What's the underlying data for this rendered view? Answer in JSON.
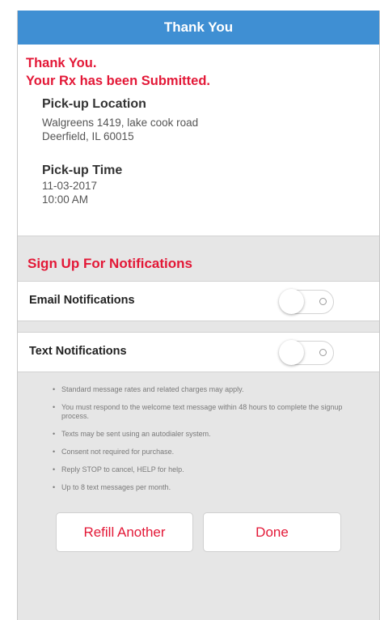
{
  "header": {
    "title": "Thank You"
  },
  "confirmation": {
    "line1": "Thank You.",
    "line2": "Your Rx has been Submitted."
  },
  "pickup_location": {
    "heading": "Pick-up Location",
    "address_line1": "Walgreens 1419, lake cook road",
    "address_line2": "Deerfield, IL 60015"
  },
  "pickup_time": {
    "heading": "Pick-up Time",
    "date": "11-03-2017",
    "time": "10:00 AM"
  },
  "notifications": {
    "heading": "Sign Up For Notifications",
    "email": {
      "label": "Email Notifications",
      "on": false
    },
    "text": {
      "label": "Text Notifications",
      "on": false
    },
    "disclaimers": [
      "Standard message rates and related charges may apply.",
      "You must respond to the welcome text message within 48 hours to complete the signup process.",
      "Texts may be sent using an autodialer system.",
      "Consent not required for purchase.",
      "Reply STOP to cancel, HELP for help.",
      "Up to 8 text messages per month."
    ]
  },
  "actions": {
    "refill_label": "Refill Another",
    "done_label": "Done"
  },
  "colors": {
    "header_blue": "#3f8fd3",
    "accent_red": "#e31837",
    "background_gray": "#e6e6e6"
  }
}
